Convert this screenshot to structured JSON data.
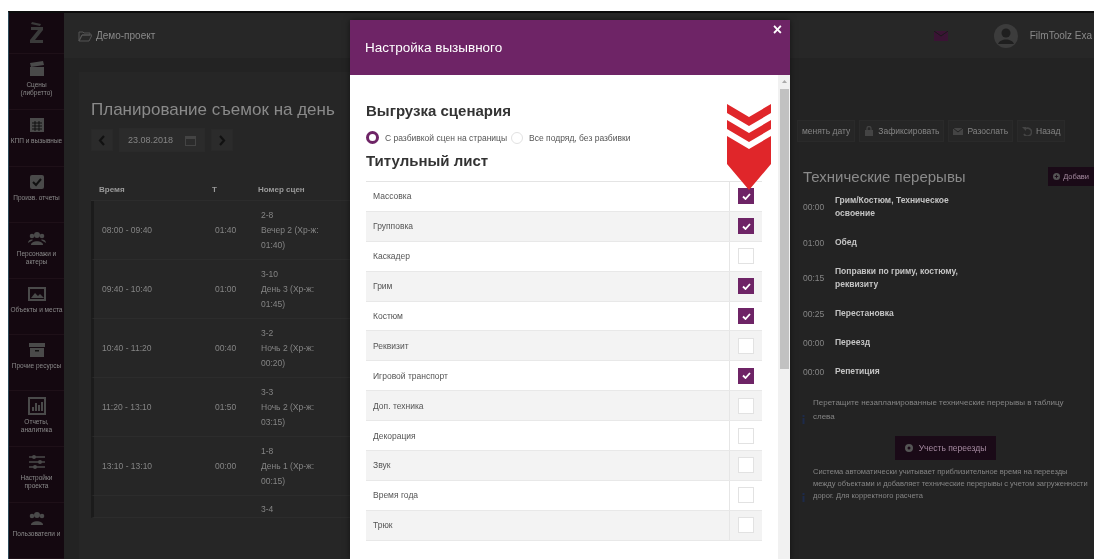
{
  "sidebar": {
    "items": [
      {
        "label": "Сцены (либретто)"
      },
      {
        "label": "КПП и вызывные"
      },
      {
        "label": "Произв. отчеты"
      },
      {
        "label": "Персонажи и актеры"
      },
      {
        "label": "Объекты и места"
      },
      {
        "label": "Прочие ресурсы"
      },
      {
        "label": "Отчеты, аналитика"
      },
      {
        "label": "Настройки проекта"
      },
      {
        "label": "Пользователи и"
      }
    ]
  },
  "topbar": {
    "project": "Демо-проект",
    "user": "FilmToolz Exa"
  },
  "planner": {
    "title": "Планирование съемок на день",
    "date": "23.08.2018",
    "columns": [
      "Время",
      "Т",
      "Номер сцен"
    ],
    "rows": [
      {
        "time": "08:00 - 09:40",
        "duration": "01:40",
        "scene": "2-8",
        "detail": "Вечер 2 (Хр-ж: 01:40)"
      },
      {
        "time": "09:40 - 10:40",
        "duration": "01:00",
        "scene": "3-10",
        "detail": "День 3 (Хр-ж: 01:45)"
      },
      {
        "time": "10:40 - 11:20",
        "duration": "00:40",
        "scene": "3-2",
        "detail": "Ночь 2 (Хр-ж: 00:20)"
      },
      {
        "time": "11:20 - 13:10",
        "duration": "01:50",
        "scene": "3-3",
        "detail": "Ночь 2 (Хр-ж: 03:15)"
      },
      {
        "time": "13:10 - 13:10",
        "duration": "00:00",
        "scene": "1-8",
        "detail": "День 1 (Хр-ж: 00:15)"
      },
      {
        "scene": "3-4"
      }
    ]
  },
  "toolbar": [
    {
      "label": "менять дату"
    },
    {
      "label": "Зафиксировать"
    },
    {
      "label": "Разослать"
    },
    {
      "label": "Назад"
    }
  ],
  "breaks": {
    "title": "Технические перерывы",
    "add_button": "Добави",
    "items": [
      {
        "time": "00:00",
        "label": "Грим/Костюм, Техническое освоение"
      },
      {
        "time": "01:00",
        "label": "Обед"
      },
      {
        "time": "00:15",
        "label": "Поправки по гриму, костюму, реквизиту"
      },
      {
        "time": "00:25",
        "label": "Перестановка"
      },
      {
        "time": "00:00",
        "label": "Переезд"
      },
      {
        "time": "00:00",
        "label": "Репетиция"
      }
    ],
    "hint": "Перетащите незапланированные технические перерывы в таблицу слева",
    "action_button": "Учесть переезды",
    "note": "Система автоматически учитывает приблизительное время на переезды между объектами и добавляет технические перерывы с учетом загруженности дорог. Для корректного расчета"
  },
  "modal": {
    "title": "Настройка вызывного",
    "close": "×",
    "export_heading": "Выгрузка сценария",
    "options": [
      {
        "label": "С разбивкой сцен на страницы",
        "selected": true
      },
      {
        "label": "Все подряд, без разбивки",
        "selected": false
      }
    ],
    "title_page_heading": "Титульный лист",
    "items": [
      {
        "label": "Массовка",
        "checked": true
      },
      {
        "label": "Групповка",
        "checked": true
      },
      {
        "label": "Каскадер",
        "checked": false
      },
      {
        "label": "Грим",
        "checked": true
      },
      {
        "label": "Костюм",
        "checked": true
      },
      {
        "label": "Реквизит",
        "checked": false
      },
      {
        "label": "Игровой транспорт",
        "checked": true
      },
      {
        "label": "Доп. техника",
        "checked": false
      },
      {
        "label": "Декорация",
        "checked": false
      },
      {
        "label": "Звук",
        "checked": false
      },
      {
        "label": "Время года",
        "checked": false
      },
      {
        "label": "Трюк",
        "checked": false
      }
    ]
  }
}
